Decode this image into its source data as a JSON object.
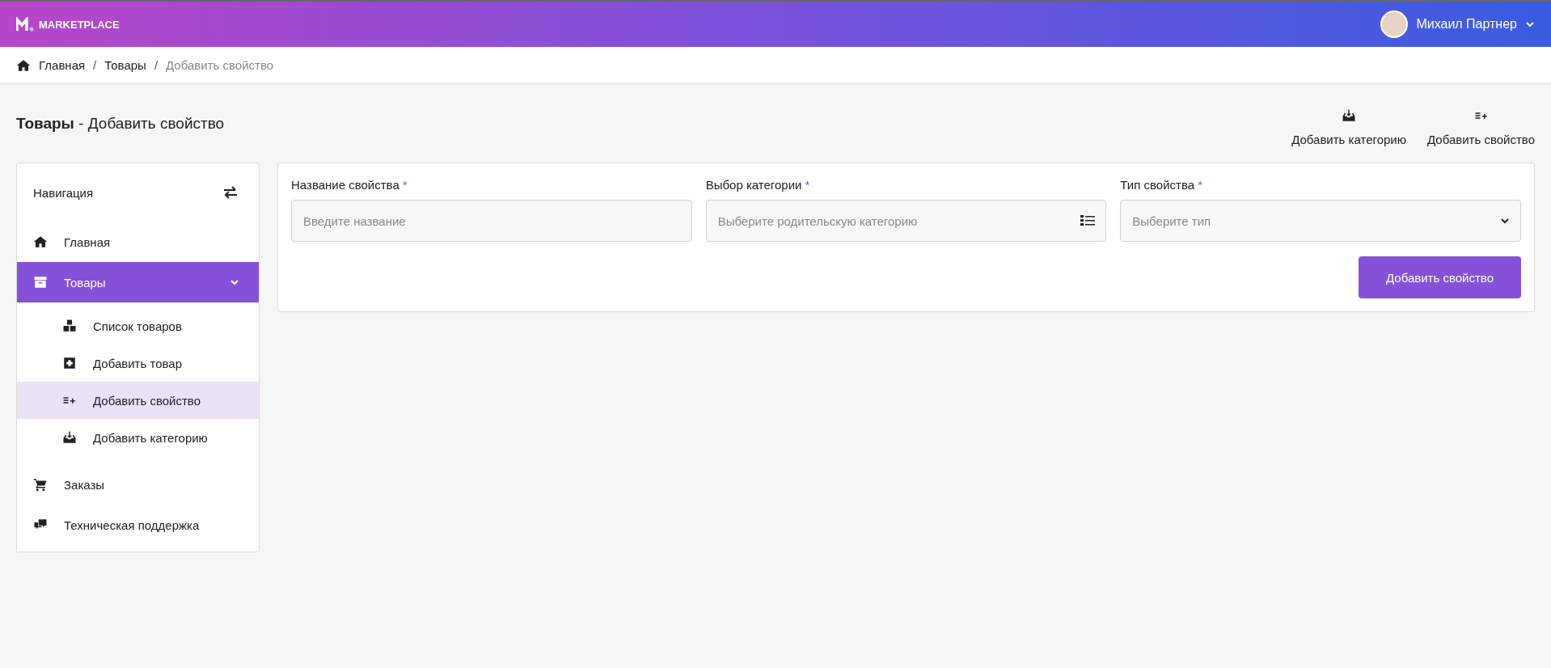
{
  "header": {
    "logo_text": "MARKETPLACE",
    "user_name": "Михаил Партнер"
  },
  "breadcrumb": [
    {
      "label": "Главная",
      "current": false
    },
    {
      "label": "Товары",
      "current": false
    },
    {
      "label": "Добавить свойство",
      "current": true
    }
  ],
  "breadcrumb_separator": "/",
  "page_title": {
    "section": "Товары",
    "rest": " - Добавить свойство"
  },
  "actions": [
    {
      "kind": "inbox",
      "label": "Добавить категорию"
    },
    {
      "kind": "listplus",
      "label": "Добавить свойство"
    }
  ],
  "sidebar": {
    "title": "Навигация",
    "items": [
      {
        "kind": "home",
        "label": "Главная",
        "selected": false
      },
      {
        "kind": "archive",
        "label": "Товары",
        "selected": true,
        "expanded": true,
        "children": [
          {
            "kind": "boxes",
            "label": "Список товаров",
            "selected": false
          },
          {
            "kind": "plus",
            "label": "Добавить товар",
            "selected": false
          },
          {
            "kind": "listplus",
            "label": "Добавить свойство",
            "selected": true
          },
          {
            "kind": "inbox",
            "label": "Добавить категорию",
            "selected": false
          }
        ]
      },
      {
        "kind": "cart",
        "label": "Заказы",
        "selected": false
      },
      {
        "kind": "chat",
        "label": "Техническая поддержка",
        "selected": false
      }
    ]
  },
  "form": {
    "fields": [
      {
        "kind": "text",
        "label": "Название свойства",
        "required_mark": "*",
        "placeholder": "Введите название"
      },
      {
        "kind": "picker",
        "label": "Выбор категории",
        "required_mark": "*",
        "placeholder": "Выберите родительскую категорию"
      },
      {
        "kind": "select",
        "label": "Тип свойства",
        "required_mark": "*",
        "placeholder": "Выберите тип"
      }
    ],
    "submit": "Добавить свойство"
  }
}
